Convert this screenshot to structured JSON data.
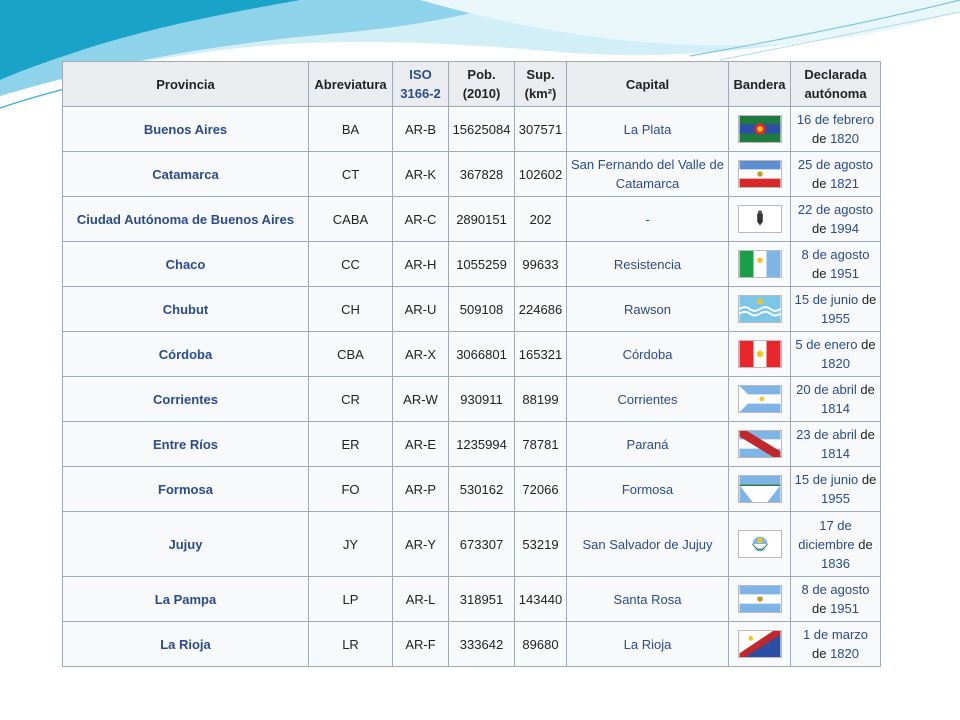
{
  "table": {
    "headers": {
      "provincia": "Provincia",
      "abreviatura": "Abreviatura",
      "iso_line1": "ISO",
      "iso_line2": "3166-2",
      "pob_line1": "Pob.",
      "pob_line2": "(2010)",
      "sup_line1": "Sup.",
      "sup_line2": "(km²)",
      "capital": "Capital",
      "bandera": "Bandera",
      "declarada_line1": "Declarada",
      "declarada_line2": "autónoma"
    },
    "rows": [
      {
        "provincia": "Buenos Aires",
        "abrev": "BA",
        "iso": "AR-B",
        "pob": "15625084",
        "sup": "307571",
        "capital": "La Plata",
        "date_link": "16 de febrero",
        "year": "1820",
        "flag_icon": "buenos-aires-flag-icon"
      },
      {
        "provincia": "Catamarca",
        "abrev": "CT",
        "iso": "AR-K",
        "pob": "367828",
        "sup": "102602",
        "capital": "San Fernando del Valle de Catamarca",
        "date_link": "25 de agosto",
        "year": "1821",
        "flag_icon": "catamarca-flag-icon"
      },
      {
        "provincia": "Ciudad Autónoma de Buenos Aires",
        "abrev": "CABA",
        "iso": "AR-C",
        "pob": "2890151",
        "sup": "202",
        "capital": "-",
        "date_link": "22 de agosto",
        "year": "1994",
        "flag_icon": "caba-flag-icon"
      },
      {
        "provincia": "Chaco",
        "abrev": "CC",
        "iso": "AR-H",
        "pob": "1055259",
        "sup": "99633",
        "capital": "Resistencia",
        "date_link": "8 de agosto",
        "year": "1951",
        "flag_icon": "chaco-flag-icon"
      },
      {
        "provincia": "Chubut",
        "abrev": "CH",
        "iso": "AR-U",
        "pob": "509108",
        "sup": "224686",
        "capital": "Rawson",
        "date_link": "15 de junio",
        "year": "1955",
        "flag_icon": "chubut-flag-icon"
      },
      {
        "provincia": "Córdoba",
        "abrev": "CBA",
        "iso": "AR-X",
        "pob": "3066801",
        "sup": "165321",
        "capital": "Córdoba",
        "date_link": "5 de enero",
        "year": "1820",
        "flag_icon": "cordoba-flag-icon"
      },
      {
        "provincia": "Corrientes",
        "abrev": "CR",
        "iso": "AR-W",
        "pob": "930911",
        "sup": "88199",
        "capital": "Corrientes",
        "date_link": "20 de abril",
        "year": "1814",
        "flag_icon": "corrientes-flag-icon"
      },
      {
        "provincia": "Entre Ríos",
        "abrev": "ER",
        "iso": "AR-E",
        "pob": "1235994",
        "sup": "78781",
        "capital": "Paraná",
        "date_link": "23 de abril",
        "year": "1814",
        "flag_icon": "entre-rios-flag-icon"
      },
      {
        "provincia": "Formosa",
        "abrev": "FO",
        "iso": "AR-P",
        "pob": "530162",
        "sup": "72066",
        "capital": "Formosa",
        "date_link": "15 de junio",
        "year": "1955",
        "flag_icon": "formosa-flag-icon"
      },
      {
        "provincia": "Jujuy",
        "abrev": "JY",
        "iso": "AR-Y",
        "pob": "673307",
        "sup": "53219",
        "capital": "San Salvador de Jujuy",
        "date_link": "17 de diciembre",
        "year": "1836",
        "flag_icon": "jujuy-flag-icon"
      },
      {
        "provincia": "La Pampa",
        "abrev": "LP",
        "iso": "AR-L",
        "pob": "318951",
        "sup": "143440",
        "capital": "Santa Rosa",
        "date_link": "8 de agosto",
        "year": "1951",
        "flag_icon": "la-pampa-flag-icon"
      },
      {
        "provincia": "La Rioja",
        "abrev": "LR",
        "iso": "AR-F",
        "pob": "333642",
        "sup": "89680",
        "capital": "La Rioja",
        "date_link": "1 de marzo",
        "year": "1820",
        "flag_icon": "la-rioja-flag-icon"
      }
    ]
  },
  "colors": {
    "link": "#2a4b8d",
    "header_bg": "#eaecf0",
    "cell_bg": "#f8f9fa",
    "border": "#a2a9b1",
    "wave_dark": "#1aa3c8",
    "wave_light": "#bfe7f3"
  }
}
